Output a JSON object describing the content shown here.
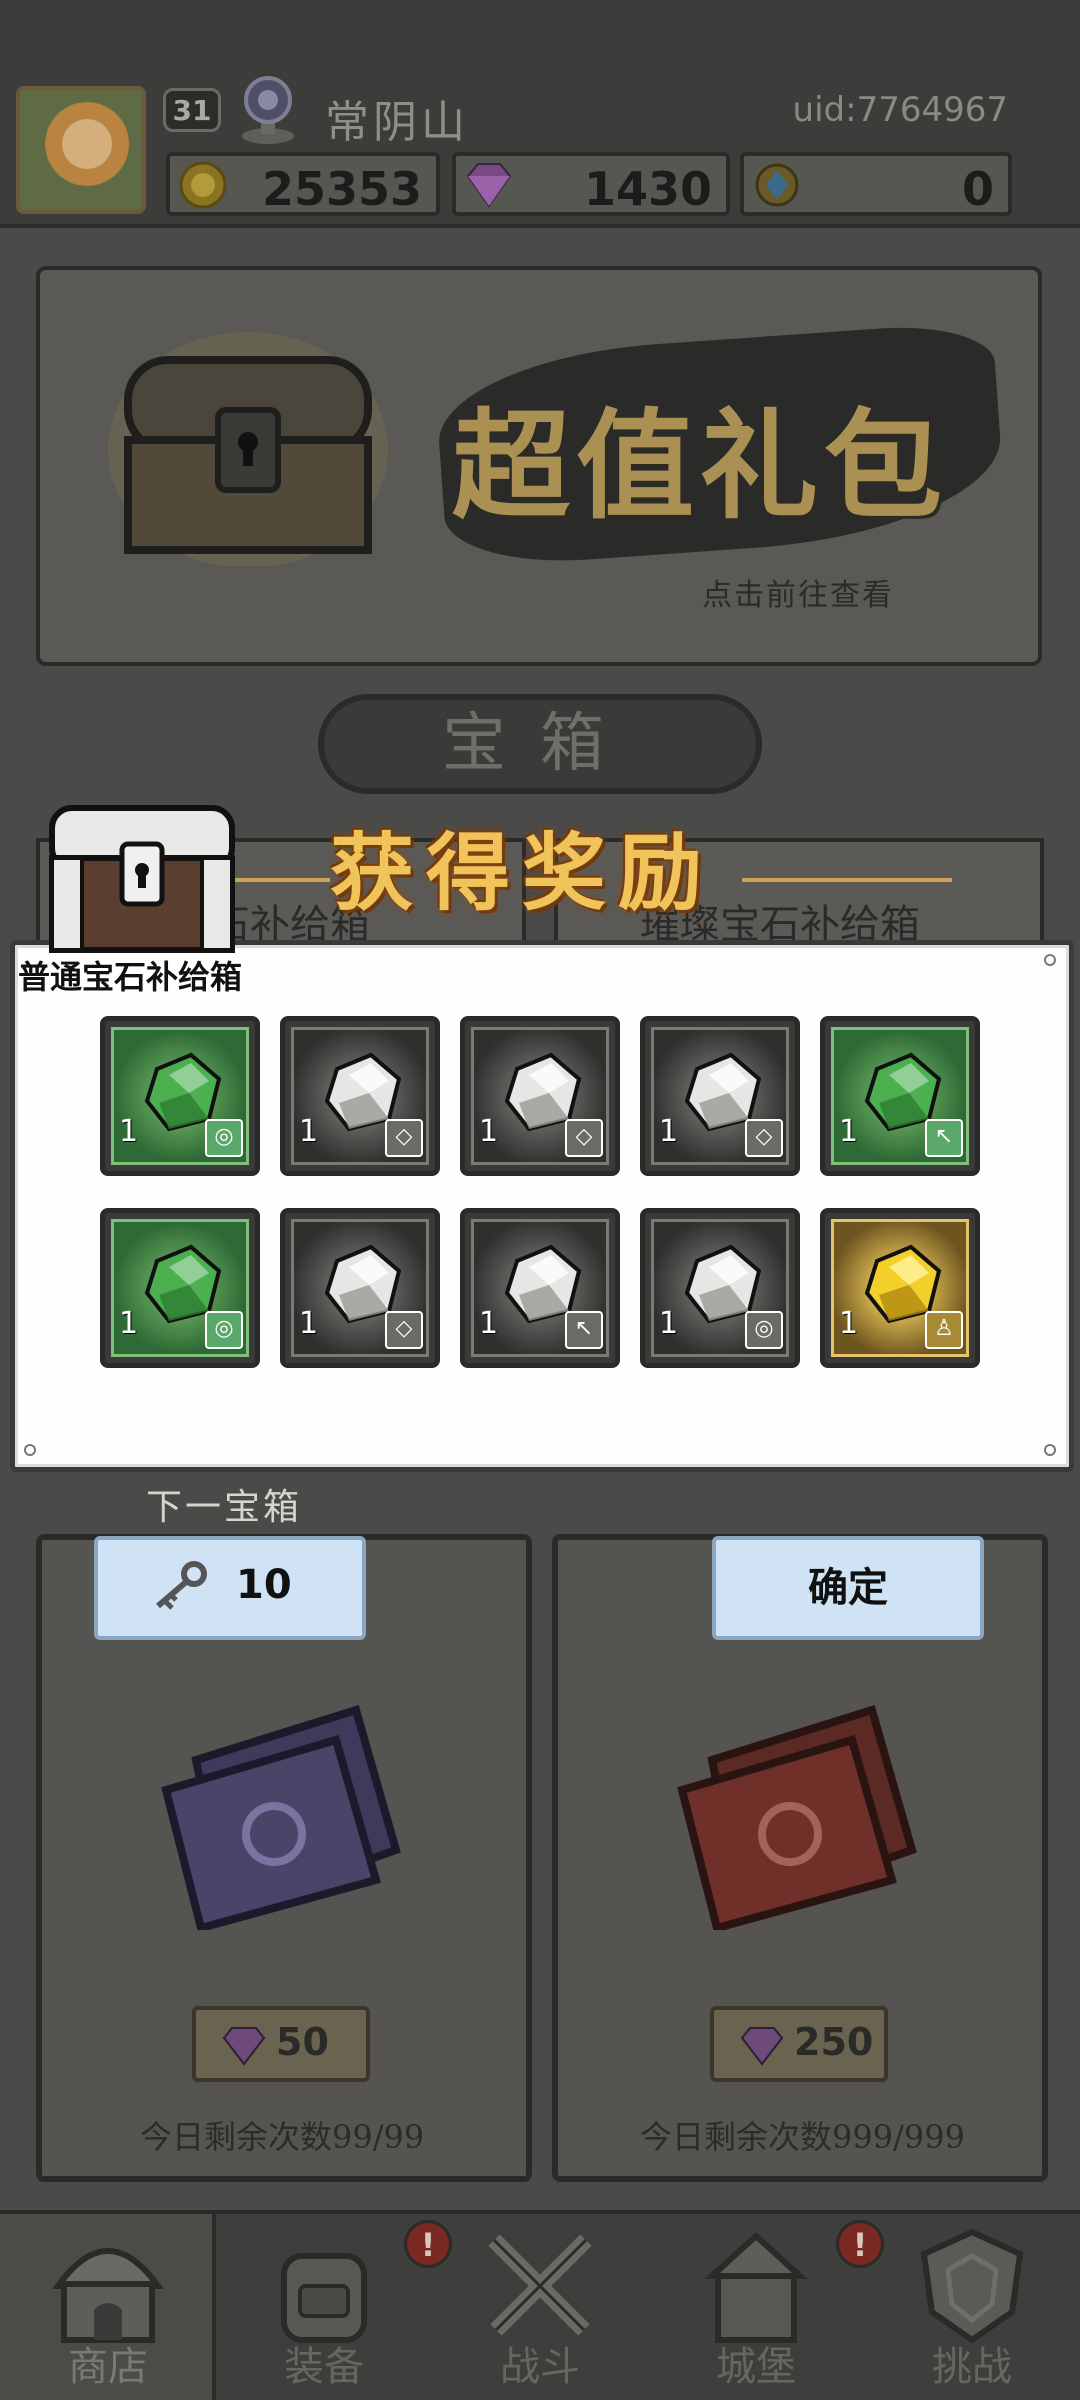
{
  "header": {
    "level": "31",
    "player_name": "常阴山",
    "uid": "uid:7764967",
    "resources": [
      {
        "name": "gold",
        "value": "25353",
        "icon": "gold-coin-icon"
      },
      {
        "name": "gem",
        "value": "1430",
        "icon": "purple-diamond-icon"
      },
      {
        "name": "crystal",
        "value": "0",
        "icon": "blue-crystal-icon"
      }
    ]
  },
  "banner": {
    "title": "超值礼包",
    "subtitle": "点击前往查看"
  },
  "section_tab": "宝箱",
  "chest_cards_top": {
    "left_title": "宝石补给箱",
    "right_title": "璀璨宝石补给箱"
  },
  "popup": {
    "title": "获得奖励",
    "chest_name": "普通宝石补给箱",
    "items": [
      {
        "type": "green",
        "qty": "1",
        "tag": "◎"
      },
      {
        "type": "gray",
        "qty": "1",
        "tag": "◇"
      },
      {
        "type": "gray",
        "qty": "1",
        "tag": "◇"
      },
      {
        "type": "gray",
        "qty": "1",
        "tag": "◇"
      },
      {
        "type": "green",
        "qty": "1",
        "tag": "↖"
      },
      {
        "type": "green",
        "qty": "1",
        "tag": "◎"
      },
      {
        "type": "gray",
        "qty": "1",
        "tag": "◇"
      },
      {
        "type": "gray",
        "qty": "1",
        "tag": "↖"
      },
      {
        "type": "gray",
        "qty": "1",
        "tag": "◎"
      },
      {
        "type": "gold",
        "qty": "1",
        "tag": "♙"
      }
    ]
  },
  "next_chest": {
    "label": "下一宝箱",
    "key_count": "10",
    "confirm": "确定"
  },
  "cards": {
    "left": {
      "price": "50",
      "remaining": "今日剩余次数99/99"
    },
    "right": {
      "price": "250",
      "remaining": "今日剩余次数999/999"
    }
  },
  "nav": {
    "items": [
      {
        "label": "商店",
        "icon": "shop-icon",
        "badge": ""
      },
      {
        "label": "装备",
        "icon": "backpack-icon",
        "badge": "!"
      },
      {
        "label": "战斗",
        "icon": "crossed-swords-icon",
        "badge": ""
      },
      {
        "label": "城堡",
        "icon": "castle-icon",
        "badge": "!"
      },
      {
        "label": "挑战",
        "icon": "shield-emblem-icon",
        "badge": ""
      }
    ]
  },
  "colors": {
    "reward_title": "#f0c45a",
    "confirm_button_bg": "#cfe3f5",
    "badge_red": "#7a2a22"
  }
}
